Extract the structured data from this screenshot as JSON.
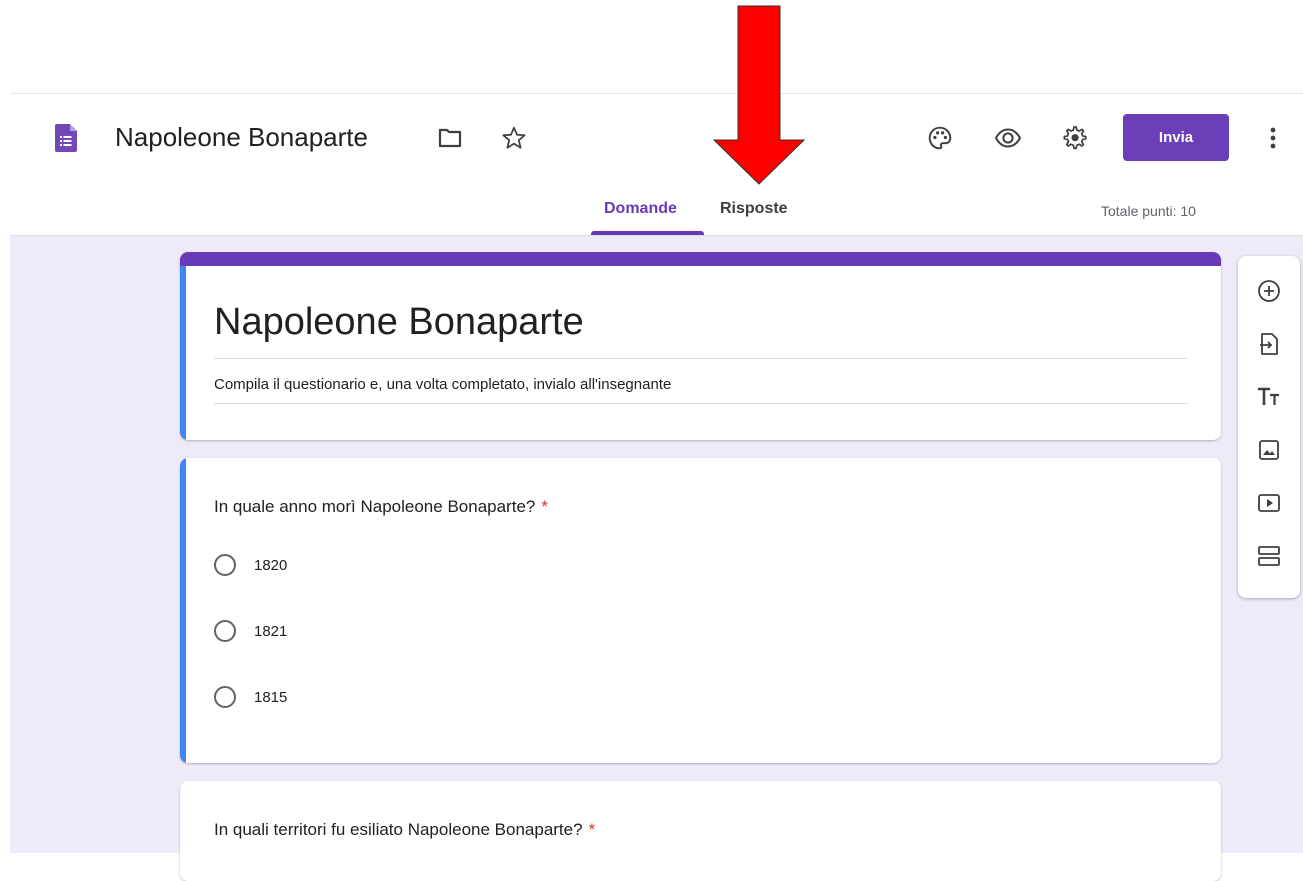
{
  "header": {
    "doc_title": "Napoleone Bonaparte",
    "send_label": "Invia",
    "tabs": [
      {
        "label": "Domande",
        "active": true
      },
      {
        "label": "Risposte",
        "active": false
      }
    ],
    "total_points": "Totale punti: 10",
    "icons": [
      "forms-logo",
      "folder-icon",
      "star-icon",
      "palette-icon",
      "eye-icon",
      "gear-icon",
      "more-vert-icon"
    ]
  },
  "form": {
    "title": "Napoleone Bonaparte",
    "description": "Compila il questionario e, una volta completato, invialo all'insegnante"
  },
  "questions": [
    {
      "text": "In quale anno morì Napoleone Bonaparte?",
      "required": "*",
      "options": [
        "1820",
        "1821",
        "1815"
      ]
    },
    {
      "text": "In quali territori fu esiliato Napoleone Bonaparte?",
      "required": "*"
    }
  ],
  "side_toolbar": [
    "add-question-icon",
    "import-questions-icon",
    "add-title-icon",
    "add-image-icon",
    "add-video-icon",
    "add-section-icon"
  ],
  "colors": {
    "accent": "#673ab7",
    "send_button": "#6b3fb8",
    "question_accent": "#4285f4",
    "canvas": "#efeaf8",
    "required": "#d93025",
    "annotation_arrow": "#ff0000"
  }
}
